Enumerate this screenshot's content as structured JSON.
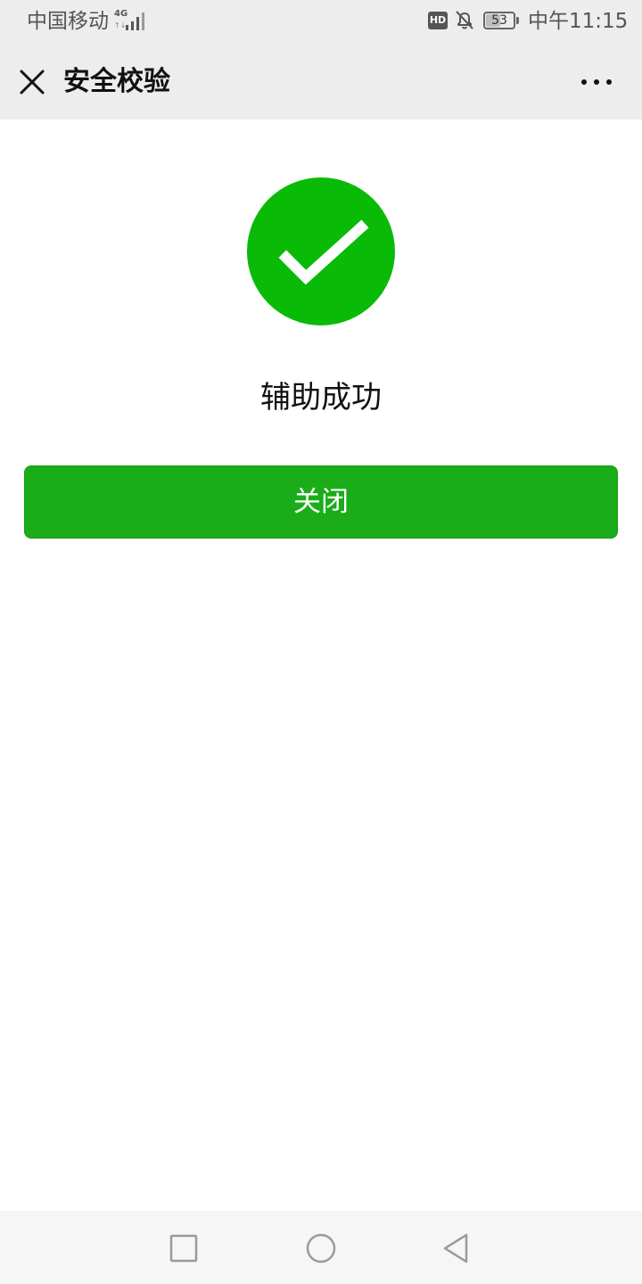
{
  "status_bar": {
    "carrier": "中国移动",
    "network_type": "4G",
    "network_arrows": "↑↓",
    "hd_badge": "HD",
    "battery_level": "53",
    "battery_fraction": 0.53,
    "time": "中午11:15"
  },
  "nav_bar": {
    "title": "安全校验",
    "close_icon": "close-icon",
    "more_icon": "more-horizontal-icon"
  },
  "result": {
    "icon": "success-check-icon",
    "title": "辅助成功"
  },
  "actions": {
    "close_label": "关闭"
  },
  "system_nav": {
    "recents_icon": "square-icon",
    "home_icon": "circle-icon",
    "back_icon": "triangle-back-icon"
  },
  "colors": {
    "accent_green": "#09bb07",
    "button_green": "#1aad19",
    "header_bg": "#ededed"
  }
}
